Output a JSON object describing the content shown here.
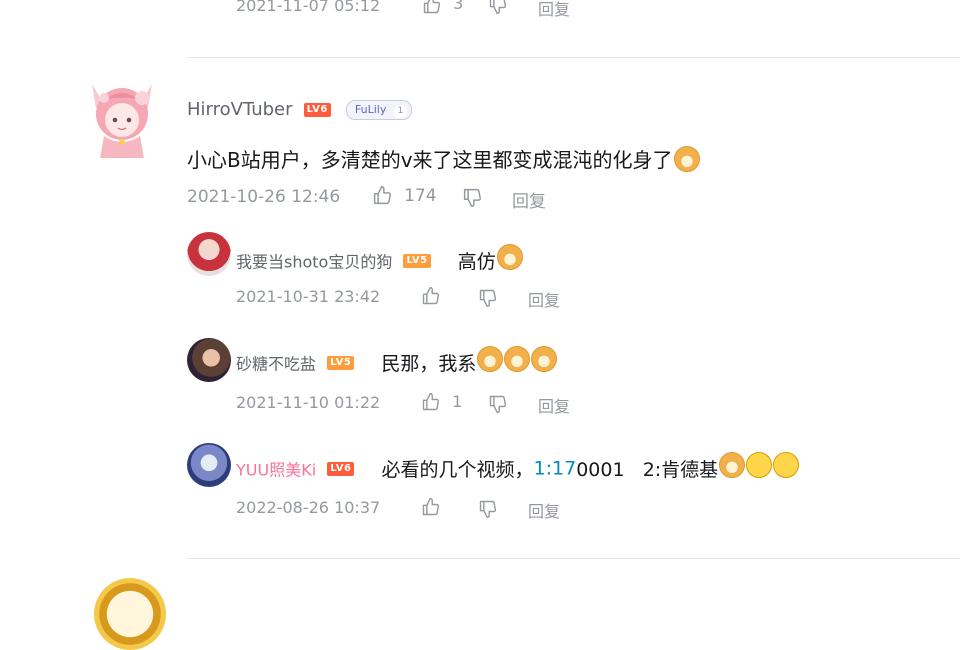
{
  "top_comment": {
    "time": "2021-11-07 05:12",
    "likes": "3",
    "reply_label": "回复"
  },
  "main_comment": {
    "username": "HirroVTuber",
    "level": "LV6",
    "fan_badge": "FuLily",
    "fan_badge_level": "1",
    "content": "小心B站用户，多清楚的v来了这里都变成混沌的化身了",
    "time": "2021-10-26 12:46",
    "likes": "174",
    "reply_label": "回复"
  },
  "replies": [
    {
      "username": "我要当shoto宝贝的狗",
      "level": "LV5",
      "content": "高仿",
      "time": "2021-10-31 23:42",
      "likes": "",
      "reply_label": "回复",
      "emojis": [
        "shiba"
      ]
    },
    {
      "username": "砂糖不吃盐",
      "level": "LV5",
      "content": "民那，我系",
      "time": "2021-11-10 01:22",
      "likes": "1",
      "reply_label": "回复",
      "emojis": [
        "shiba",
        "shiba",
        "shiba"
      ]
    },
    {
      "username": "YUU照美Ki",
      "level": "LV6",
      "content_prefix": "必看的几个视频，",
      "link_text": "1:17",
      "content_after_link": "0001   2:肯德基",
      "time": "2022-08-26 10:37",
      "likes": "",
      "reply_label": "回复",
      "emojis": [
        "shiba",
        "smile",
        "smile"
      ]
    }
  ],
  "colors": {
    "text": "#18191c",
    "meta": "#9499a0",
    "vip_name": "#fb7299",
    "link": "#008ac5",
    "lv5": "#ff9d3c",
    "lv6": "#ff5c3c",
    "divider": "#e3e5e7"
  },
  "icons": {
    "like": "thumb-up-icon",
    "dislike": "thumb-down-icon"
  }
}
